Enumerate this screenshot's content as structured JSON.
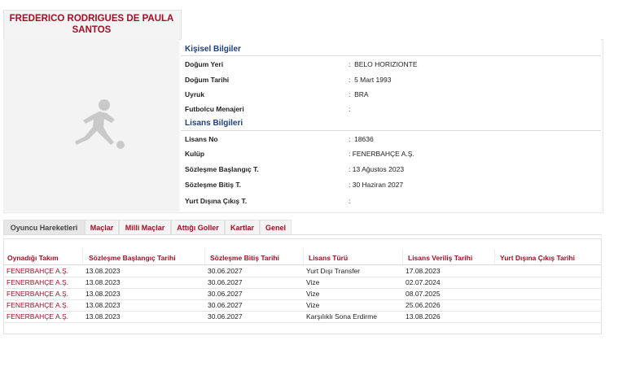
{
  "player": {
    "name": "FREDERICO RODRIGUES DE PAULA SANTOS"
  },
  "personal": {
    "title": "Kişisel Bilgiler",
    "fields": [
      {
        "label": "Doğum Yeri",
        "value": ":  BELO HORIZIONTE"
      },
      {
        "label": "Doğum Tarihi",
        "value": ":  5 Mart 1993"
      },
      {
        "label": "Uyruk",
        "value": ":  BRA"
      },
      {
        "label": "Futbolcu Menajeri",
        "value": ":"
      }
    ]
  },
  "license": {
    "title": "Lisans Bilgileri",
    "fields": [
      {
        "label": "Lisans No",
        "value": ":  18636"
      },
      {
        "label": "Kulüp",
        "value": ": FENERBAHÇE A.Ş."
      },
      {
        "label": "Sözleşme Başlangıç T.",
        "value": ": 13 Ağustos 2023"
      },
      {
        "label": "Sözleşme Bitiş T.",
        "value": ": 30 Haziran 2027"
      },
      {
        "label": "Yurt Dışına Çıkış T.",
        "value": ":"
      }
    ]
  },
  "tabs": [
    "Oyuncu Hareketleri",
    "Maçlar",
    "Milli Maçlar",
    "Attığı Goller",
    "Kartlar",
    "Genel"
  ],
  "table": {
    "headers": [
      "Oynadığı Takım",
      "Sözleşme Başlangıç Tarihi",
      "Sözleşme Bitiş Tarihi",
      "Lisans Türü",
      "Lisans Veriliş Tarihi",
      "Yurt Dışına Çıkış Tarihi"
    ],
    "rows": [
      [
        "FENERBAHÇE A.Ş.",
        "13.08.2023",
        "30.06.2027",
        "Yurt Dışı Transfer",
        "17.08.2023",
        ""
      ],
      [
        "FENERBAHÇE A.Ş.",
        "13.08.2023",
        "30.06.2027",
        "Vize",
        "02.07.2024",
        ""
      ],
      [
        "FENERBAHÇE A.Ş.",
        "13.08.2023",
        "30.06.2027",
        "Vize",
        "08.07.2025",
        ""
      ],
      [
        "FENERBAHÇE A.Ş.",
        "13.08.2023",
        "30.06.2027",
        "Vize",
        "25.06.2026",
        ""
      ],
      [
        "FENERBAHÇE A.Ş.",
        "13.08.2023",
        "30.06.2027",
        "Karşılıklı Sona Erdirme",
        "13.08.2026",
        ""
      ]
    ]
  },
  "icons": {
    "player_photo": "football-player-silhouette-icon"
  },
  "colors": {
    "accent": "#a40d25",
    "section_title": "#1f3f79"
  }
}
